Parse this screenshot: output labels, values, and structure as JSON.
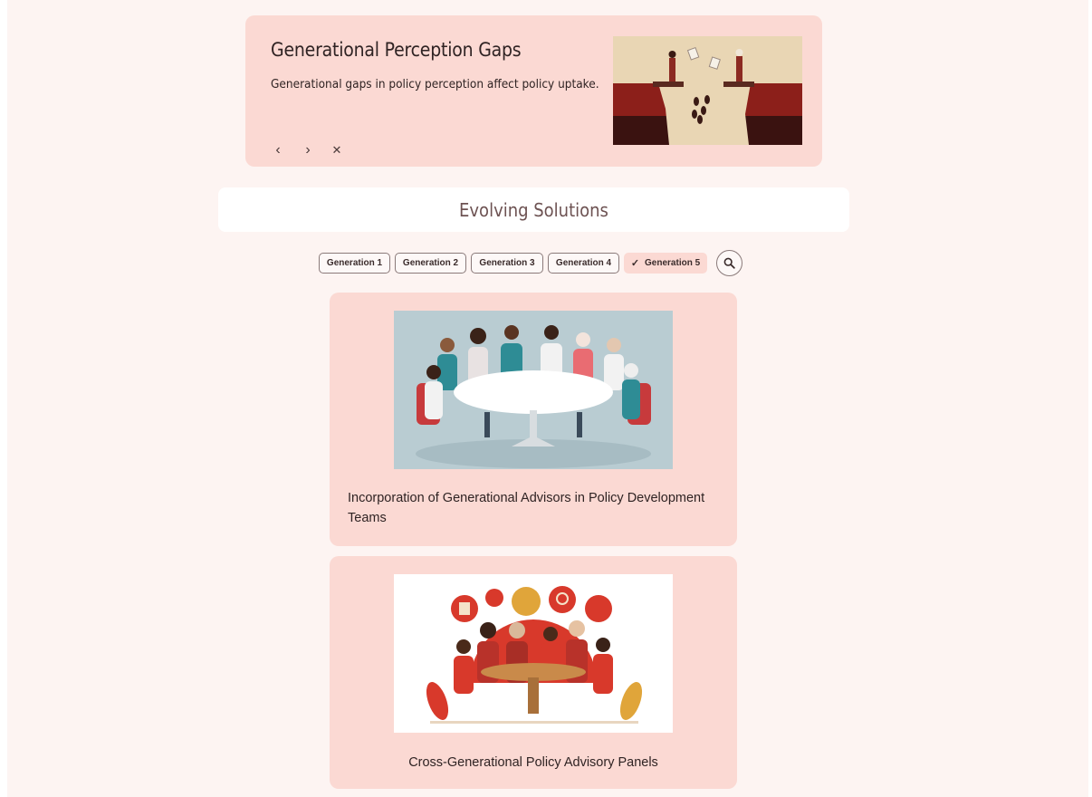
{
  "banner": {
    "title": "Generational Perception Gaps",
    "subtitle": "Generational gaps in policy perception affect policy uptake.",
    "prev_icon": "‹",
    "next_icon": "›",
    "close_icon": "✕"
  },
  "section": {
    "heading": "Evolving Solutions"
  },
  "filters": {
    "chips": [
      "Generation 1",
      "Generation 2",
      "Generation 3",
      "Generation 4",
      "Generation 5"
    ],
    "selected": "Generation 5",
    "check_icon": "✓"
  },
  "cards": [
    {
      "title": "Incorporation of Generational Advisors in Policy Development Teams"
    },
    {
      "title": "Cross-Generational Policy Advisory Panels"
    }
  ],
  "colors": {
    "background": "#fdf4f2",
    "card": "#fbd9d3",
    "heading": "#6d5252",
    "accent_red": "#d8392b"
  }
}
